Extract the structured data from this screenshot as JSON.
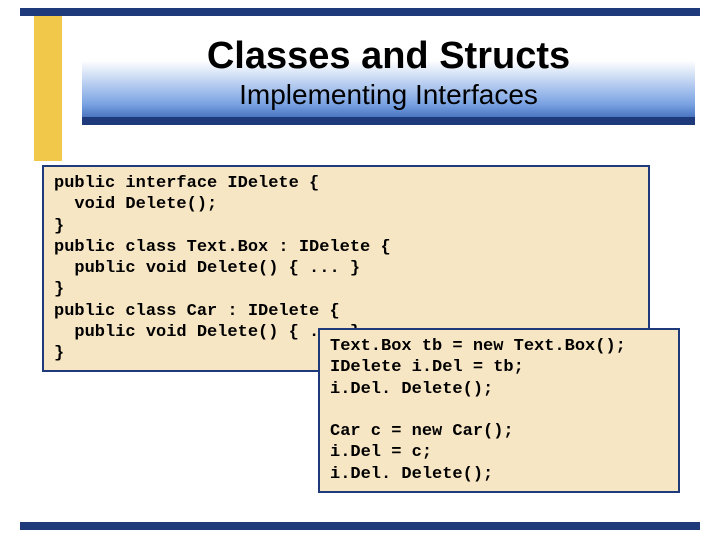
{
  "title": {
    "main": "Classes and Structs",
    "sub": "Implementing Interfaces"
  },
  "code1": "public interface IDelete {\n  void Delete();\n}\npublic class Text.Box : IDelete {\n  public void Delete() { ... }\n}\npublic class Car : IDelete {\n  public void Delete() { ... }\n}",
  "code2": "Text.Box tb = new Text.Box();\nIDelete i.Del = tb;\ni.Del. Delete();\n\nCar c = new Car();\ni.Del = c;\ni.Del. Delete();"
}
